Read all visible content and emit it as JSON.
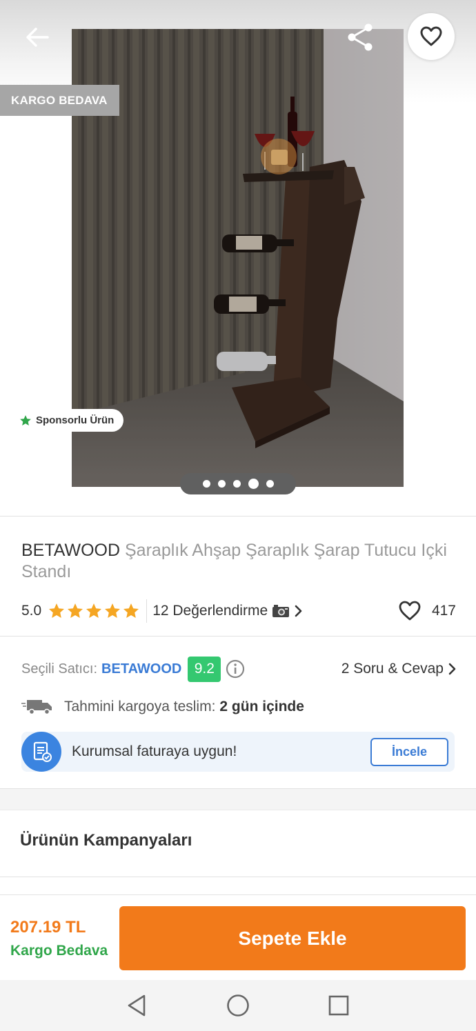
{
  "header": {
    "badge_free_shipping": "KARGO BEDAVA",
    "sponsored_label": "Sponsorlu Ürün",
    "carousel": {
      "total": 5,
      "active_index": 3
    }
  },
  "product": {
    "brand": "BETAWOOD",
    "name": " Şaraplık Ahşap Şaraplık Şarap Tutucu Içki Standı",
    "rating": "5.0",
    "stars": 5,
    "reviews_label": "12 Değerlendirme",
    "likes": "417"
  },
  "seller": {
    "label": "Seçili Satıcı:",
    "name": "BETAWOOD",
    "score": "9.2",
    "qa_label": "2 Soru & Cevap"
  },
  "delivery": {
    "label": "Tahmini kargoya teslim:",
    "value": "2 gün içinde"
  },
  "corporate": {
    "text": "Kurumsal faturaya uygun!",
    "button": "İncele"
  },
  "campaigns": {
    "title": "Ürünün Kampanyaları"
  },
  "purchase": {
    "price": "207.19 TL",
    "shipping": "Kargo Bedava",
    "cart_button": "Sepete Ekle"
  },
  "colors": {
    "accent_orange": "#f27a1a",
    "star_orange": "#f5a623",
    "green": "#30a64a",
    "score_green": "#34c870",
    "link_blue": "#3a7bd5"
  }
}
